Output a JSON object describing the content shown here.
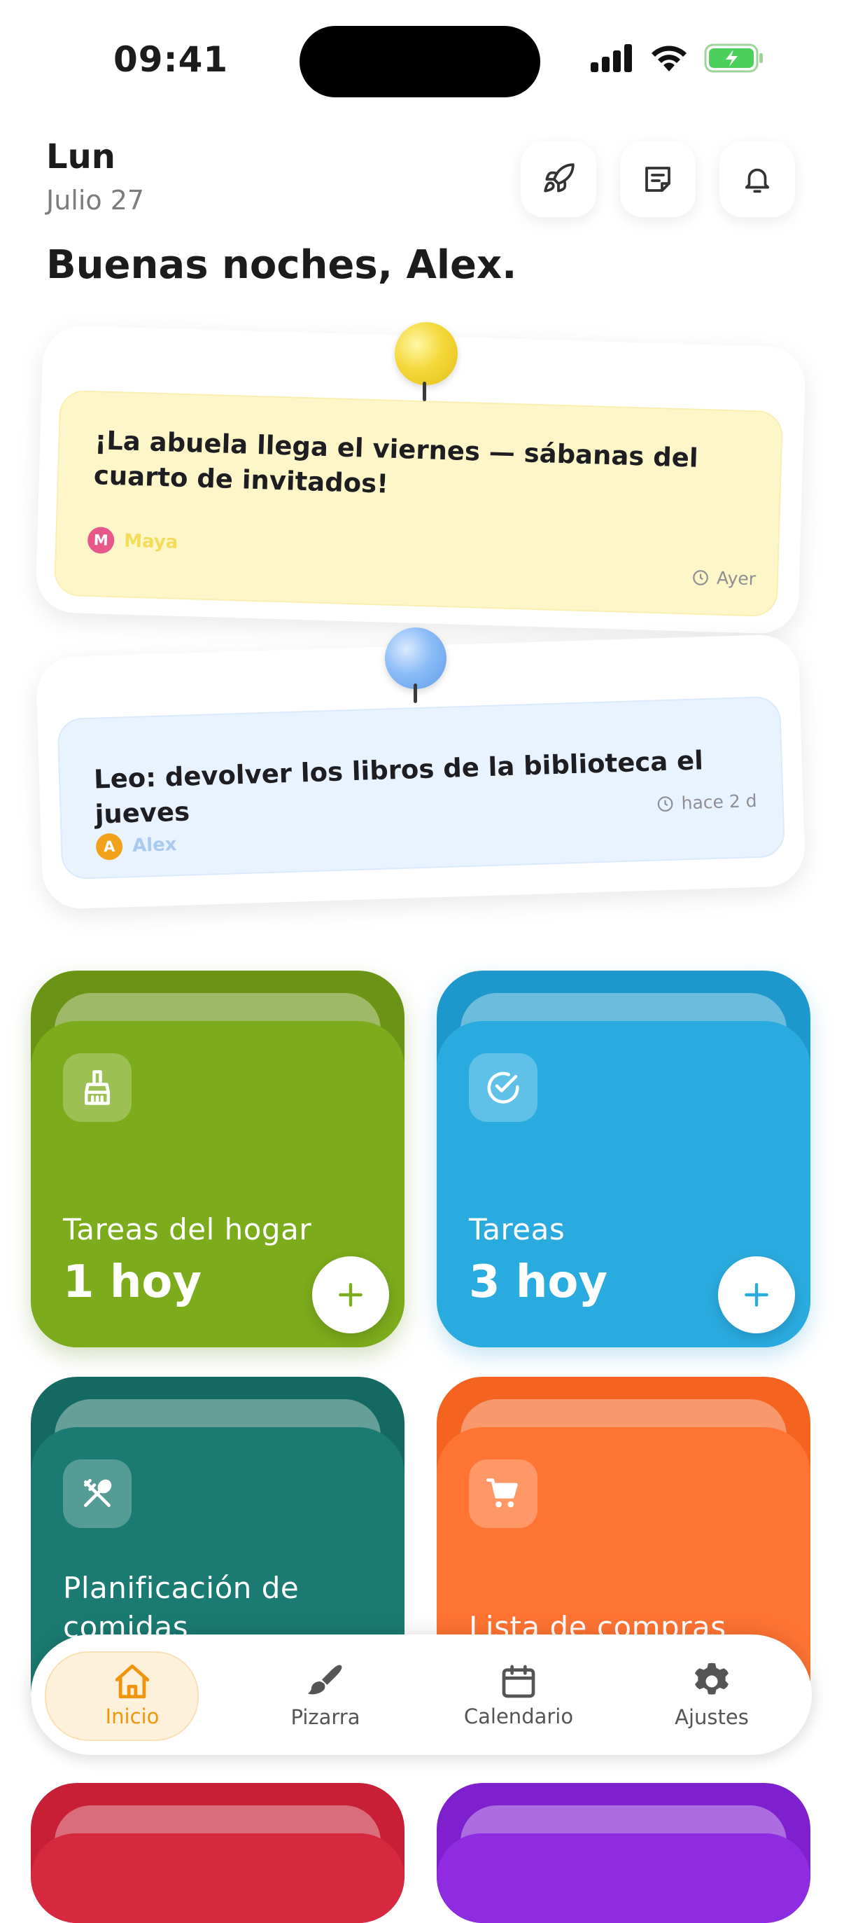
{
  "status_bar": {
    "time": "09:41"
  },
  "header": {
    "day": "Lun",
    "date": "Julio 27",
    "greeting": "Buenas noches, Alex.",
    "actions": [
      "rocket-icon",
      "note-icon",
      "bell-icon"
    ]
  },
  "notes": [
    {
      "text": "¡La abuela llega el viernes — sábanas del cuarto de invitados!",
      "author": "Maya",
      "initial": "M",
      "time": "Ayer",
      "color": "#fdf6c9",
      "pin_color": "#f4d83a",
      "avatar_color": "#e8578a",
      "author_color": "#f2dc5a"
    },
    {
      "text": "Leo: devolver los libros de la biblioteca el jueves",
      "author": "Alex",
      "initial": "A",
      "time": "hace 2 d",
      "color": "#e9f3ff",
      "pin_color": "#7fb4f6",
      "avatar_color": "#f2a21a",
      "author_color": "#a9c9f0"
    }
  ],
  "tiles": [
    {
      "title": "Tareas del hogar",
      "count": "1 hoy",
      "icon": "broom-icon",
      "color": "#7cab1c",
      "back_color": "#6b9416",
      "has_add": true
    },
    {
      "title": "Tareas",
      "count": "3 hoy",
      "icon": "check-circle-icon",
      "color": "#2aabe0",
      "back_color": "#1e98cc",
      "has_add": true
    },
    {
      "title": "Planificación de comidas",
      "count": "",
      "icon": "utensils-icon",
      "color": "#1b7b72",
      "back_color": "#146a62",
      "has_add": false
    },
    {
      "title": "Lista de compras",
      "count": "",
      "icon": "cart-icon",
      "color": "#ff7433",
      "back_color": "#f4631f",
      "has_add": false
    },
    {
      "title": "",
      "count": "",
      "icon": "",
      "color": "#d6293f",
      "back_color": "#c71f35",
      "has_add": false
    },
    {
      "title": "",
      "count": "",
      "icon": "",
      "color": "#8f2be0",
      "back_color": "#7f20cf",
      "has_add": false
    }
  ],
  "tabs": [
    {
      "label": "Inicio",
      "icon": "home-icon",
      "active": true
    },
    {
      "label": "Pizarra",
      "icon": "brush-icon",
      "active": false
    },
    {
      "label": "Calendario",
      "icon": "calendar-icon",
      "active": false
    },
    {
      "label": "Ajustes",
      "icon": "gear-icon",
      "active": false
    }
  ]
}
